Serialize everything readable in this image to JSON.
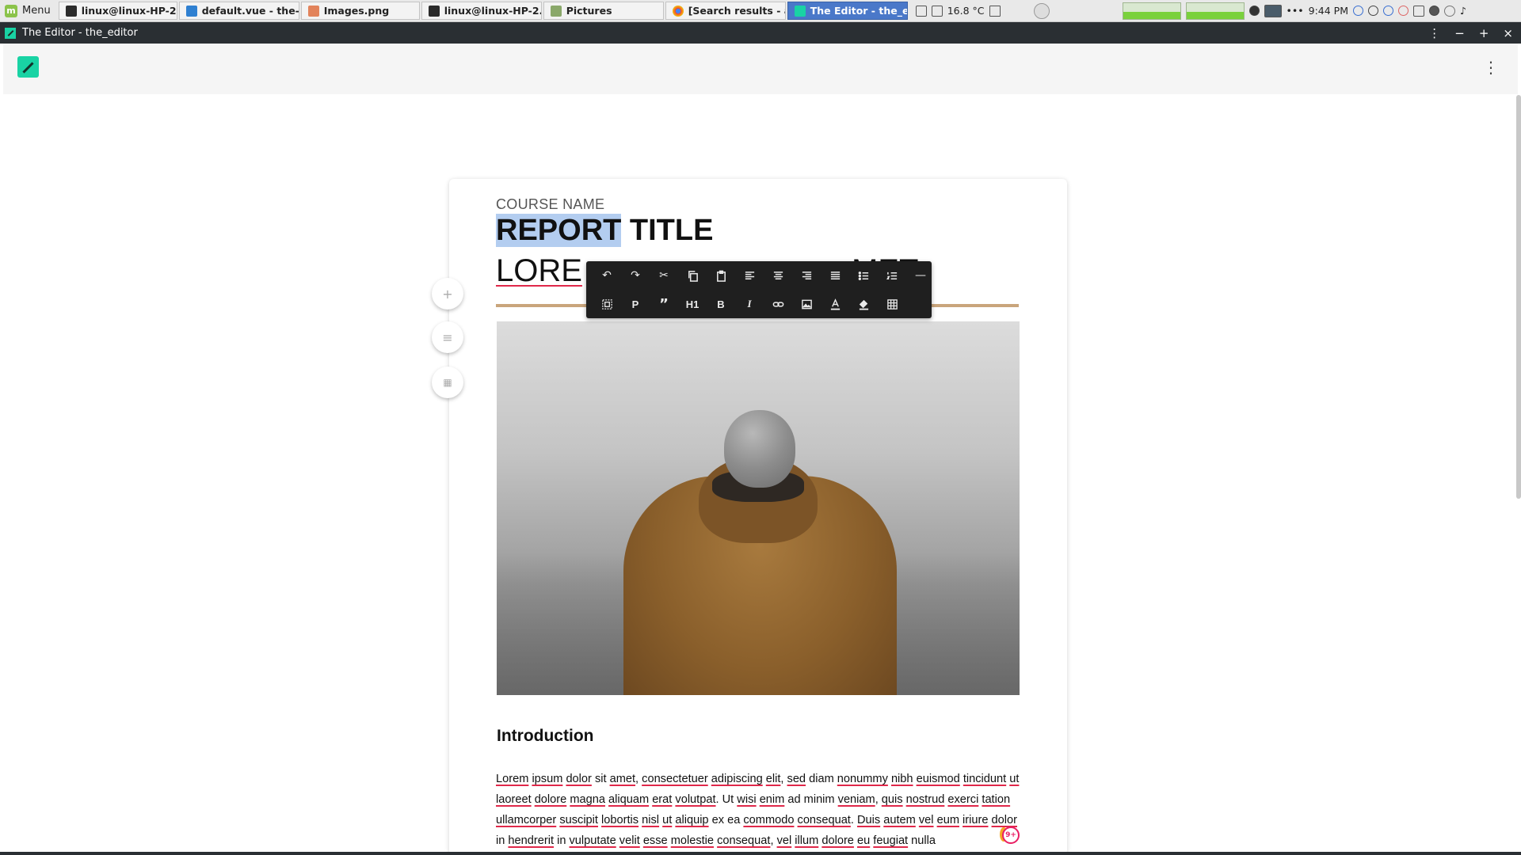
{
  "taskbar": {
    "menu_label": "Menu",
    "tasks": [
      {
        "label": "linux@linux-HP-2...",
        "icon": "terminal-icon"
      },
      {
        "label": "default.vue - the-...",
        "icon": "vscode-icon"
      },
      {
        "label": "Images.png",
        "icon": "image-viewer-icon"
      },
      {
        "label": "linux@linux-HP-2...",
        "icon": "terminal-icon"
      },
      {
        "label": "Pictures",
        "icon": "folder-icon"
      },
      {
        "label": "[Search results - a...",
        "icon": "chrome-icon"
      },
      {
        "label": "The Editor - the_e...",
        "icon": "editor-app-icon",
        "active": true
      }
    ],
    "temperature": "16.8 °C",
    "time": "9:44 PM"
  },
  "window": {
    "title": "The Editor - the_editor"
  },
  "document": {
    "course_name": "COURSE NAME",
    "title_selected": "REPORT",
    "title_rest": " TITLE",
    "subtitle_left": "LORE",
    "subtitle_right": "MET",
    "section_heading": "Introduction",
    "paragraph": [
      {
        "t": "Lorem",
        "s": true
      },
      {
        "t": " "
      },
      {
        "t": "ipsum",
        "s": true
      },
      {
        "t": " "
      },
      {
        "t": "dolor",
        "s": true
      },
      {
        "t": " sit "
      },
      {
        "t": "amet",
        "s": true
      },
      {
        "t": ", "
      },
      {
        "t": "consectetuer",
        "s": true
      },
      {
        "t": " "
      },
      {
        "t": "adipiscing",
        "s": true
      },
      {
        "t": " "
      },
      {
        "t": "elit",
        "s": true
      },
      {
        "t": ", "
      },
      {
        "t": "sed",
        "s": true
      },
      {
        "t": " diam "
      },
      {
        "t": "nonummy",
        "s": true
      },
      {
        "t": " "
      },
      {
        "t": "nibh",
        "s": true
      },
      {
        "t": " "
      },
      {
        "t": "euismod",
        "s": true
      },
      {
        "t": " "
      },
      {
        "t": "tincidunt",
        "s": true
      },
      {
        "t": " "
      },
      {
        "t": "ut",
        "s": true
      },
      {
        "t": " "
      },
      {
        "t": "laoreet",
        "s": true
      },
      {
        "t": " "
      },
      {
        "t": "dolore",
        "s": true
      },
      {
        "t": " "
      },
      {
        "t": "magna",
        "s": true
      },
      {
        "t": " "
      },
      {
        "t": "aliquam",
        "s": true
      },
      {
        "t": " "
      },
      {
        "t": "erat",
        "s": true
      },
      {
        "t": " "
      },
      {
        "t": "volutpat",
        "s": true
      },
      {
        "t": ". Ut "
      },
      {
        "t": "wisi",
        "s": true
      },
      {
        "t": " "
      },
      {
        "t": "enim",
        "s": true
      },
      {
        "t": " ad minim "
      },
      {
        "t": "veniam",
        "s": true
      },
      {
        "t": ", "
      },
      {
        "t": "quis",
        "s": true
      },
      {
        "t": " "
      },
      {
        "t": "nostrud",
        "s": true
      },
      {
        "t": " "
      },
      {
        "t": "exerci",
        "s": true
      },
      {
        "t": " "
      },
      {
        "t": "tation",
        "s": true
      },
      {
        "t": " "
      },
      {
        "t": "ullamcorper",
        "s": true
      },
      {
        "t": " "
      },
      {
        "t": "suscipit",
        "s": true
      },
      {
        "t": " "
      },
      {
        "t": "lobortis",
        "s": true
      },
      {
        "t": " "
      },
      {
        "t": "nisl",
        "s": true
      },
      {
        "t": " "
      },
      {
        "t": "ut",
        "s": true
      },
      {
        "t": " "
      },
      {
        "t": "aliquip",
        "s": true
      },
      {
        "t": " ex ea "
      },
      {
        "t": "commodo",
        "s": true
      },
      {
        "t": " "
      },
      {
        "t": "consequat",
        "s": true
      },
      {
        "t": ". "
      },
      {
        "t": "Duis",
        "s": true
      },
      {
        "t": " "
      },
      {
        "t": "autem",
        "s": true
      },
      {
        "t": " "
      },
      {
        "t": "vel",
        "s": true
      },
      {
        "t": " "
      },
      {
        "t": "eum",
        "s": true
      },
      {
        "t": " "
      },
      {
        "t": "iriure",
        "s": true
      },
      {
        "t": " "
      },
      {
        "t": "dolor",
        "s": true
      },
      {
        "t": " in "
      },
      {
        "t": "hendrerit",
        "s": true
      },
      {
        "t": " in "
      },
      {
        "t": "vulputate",
        "s": true
      },
      {
        "t": " "
      },
      {
        "t": "velit",
        "s": true
      },
      {
        "t": " "
      },
      {
        "t": "esse",
        "s": true
      },
      {
        "t": " "
      },
      {
        "t": "molestie",
        "s": true
      },
      {
        "t": " "
      },
      {
        "t": "consequat",
        "s": true
      },
      {
        "t": ", "
      },
      {
        "t": "vel",
        "s": true
      },
      {
        "t": " "
      },
      {
        "t": "illum",
        "s": true
      },
      {
        "t": " "
      },
      {
        "t": "dolore",
        "s": true
      },
      {
        "t": " "
      },
      {
        "t": "eu",
        "s": true
      },
      {
        "t": " "
      },
      {
        "t": "feugiat",
        "s": true
      },
      {
        "t": " nulla"
      }
    ],
    "badge_label": "9+"
  },
  "toolbar": {
    "row1": [
      "undo-icon",
      "redo-icon",
      "cut-icon",
      "copy-icon",
      "paste-icon",
      "align-left-icon",
      "align-center-icon",
      "align-right-icon",
      "align-justify-icon",
      "bullet-list-icon",
      "numbered-list-icon",
      "horizontal-rule-icon"
    ],
    "row2_labels": {
      "paragraph": "P",
      "heading": "H1",
      "bold": "B",
      "italic": "I"
    }
  },
  "side_buttons": [
    "add-block-icon",
    "menu-icon",
    "grid-icon"
  ],
  "colors": {
    "accent": "#19d3a4",
    "rule": "#c9a57c",
    "spellcheck": "#e0284a",
    "active_task": "#4a78c9",
    "toolbar_bg": "#1f1f1f"
  }
}
